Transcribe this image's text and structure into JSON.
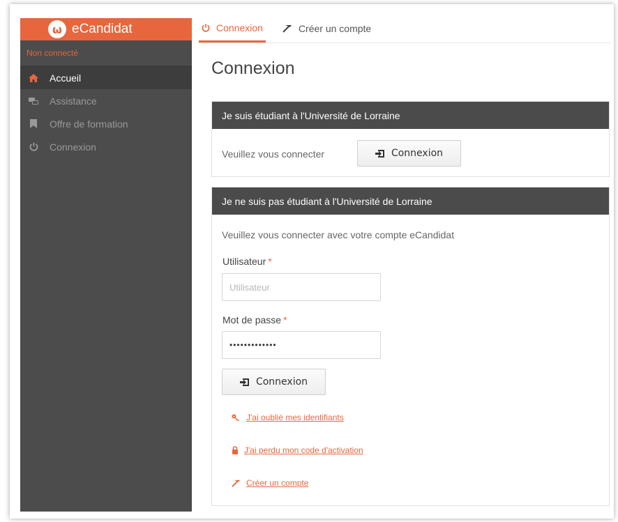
{
  "app": {
    "logo_letter": "ω",
    "brand_name": "eCandidat",
    "connection_status": "Non connecté"
  },
  "sidebar": {
    "items": [
      {
        "label": "Accueil",
        "icon": "home-icon",
        "active": true
      },
      {
        "label": "Assistance",
        "icon": "support-icon",
        "active": false
      },
      {
        "label": "Offre de formation",
        "icon": "bookmark-icon",
        "active": false
      },
      {
        "label": "Connexion",
        "icon": "power-icon",
        "active": false
      }
    ]
  },
  "tabs": [
    {
      "label": "Connexion",
      "icon": "power-icon",
      "active": true
    },
    {
      "label": "Créer un compte",
      "icon": "magic-wand-icon",
      "active": false
    }
  ],
  "page": {
    "title": "Connexion"
  },
  "panel_student": {
    "heading": "Je suis étudiant à l'Université de Lorraine",
    "prompt": "Veuillez vous connecter",
    "button_label": "Connexion"
  },
  "panel_other": {
    "heading": "Je ne suis pas étudiant à l'Université de Lorraine",
    "prompt": "Veuillez vous connecter avec votre compte eCandidat",
    "username_label": "Utilisateur",
    "username_placeholder": "Utilisateur",
    "username_value": "",
    "password_label": "Mot de passe",
    "password_value": "•••••••••••••",
    "required_mark": "*",
    "button_label": "Connexion",
    "links": [
      {
        "label": "J'ai oublié mes identifiants",
        "icon": "key-icon"
      },
      {
        "label": "J'ai perdu mon code d'activation",
        "icon": "lock-icon"
      },
      {
        "label": "Créer un compte",
        "icon": "magic-wand-icon"
      }
    ]
  },
  "colors": {
    "accent": "#e8663d",
    "sidebar_bg": "#4c4c4c",
    "panel_header_bg": "#4b4b4b"
  }
}
